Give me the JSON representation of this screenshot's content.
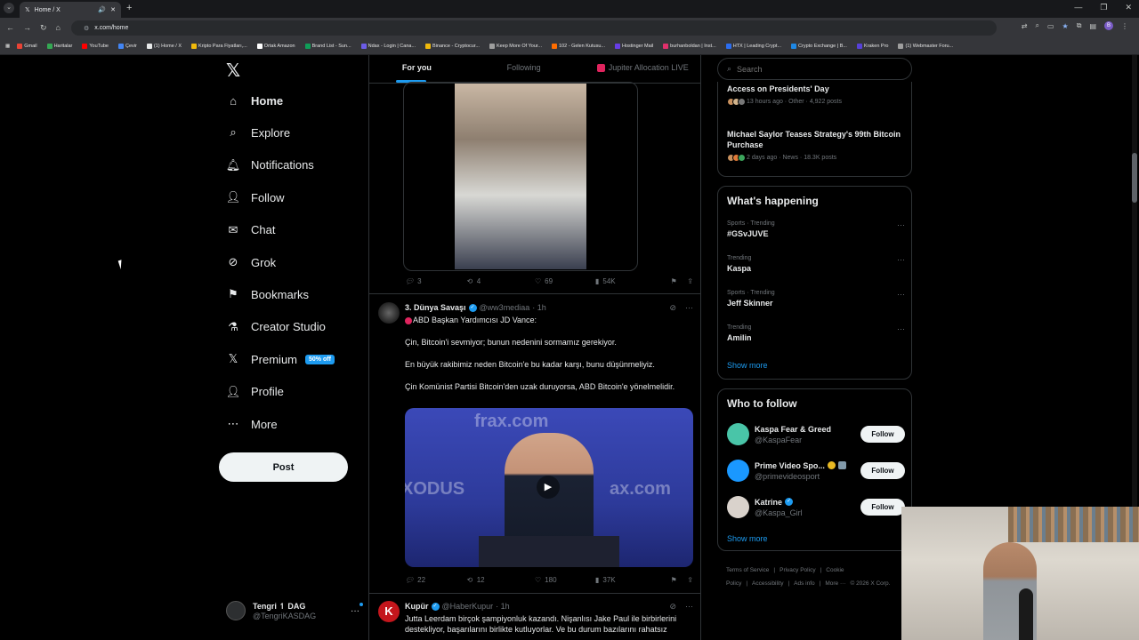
{
  "browser": {
    "tab_title": "Home / X",
    "url": "x.com/home",
    "bookmarks": [
      "Gmail",
      "Haritalar",
      "YouTube",
      "Çevir",
      "(1) Home / X",
      "Kripto Para Fiyatları,...",
      "Ortak Amazon",
      "Brand List - Sun...",
      "Ndax - Login | Cana...",
      "Binance - Cryptocur...",
      "Keep More Of Your...",
      "102 - Gelen Kutusu...",
      "Hostinger Mail",
      "burhanboldan | Inst...",
      "HTX | Leading Crypt...",
      "Crypto Exchange | B...",
      "Kraken Pro",
      "(1) Webmaster Foru..."
    ],
    "bookmark_colors": [
      "#ea4335",
      "#34a853",
      "#ff0000",
      "#4285f4",
      "#e7e9ea",
      "#f0b90b",
      "#ffffff",
      "#0f9d58",
      "#6c5ce7",
      "#f0b90b",
      "#9e9e9e",
      "#ff6d00",
      "#673de6",
      "#e1306c",
      "#2b6def",
      "#1e88e5",
      "#5741d9",
      "#9e9e9e"
    ]
  },
  "nav": {
    "items": [
      {
        "label": "Home",
        "icon": "home-icon",
        "active": true
      },
      {
        "label": "Explore",
        "icon": "search-icon"
      },
      {
        "label": "Notifications",
        "icon": "bell-icon"
      },
      {
        "label": "Follow",
        "icon": "person-plus-icon"
      },
      {
        "label": "Chat",
        "icon": "mail-icon"
      },
      {
        "label": "Grok",
        "icon": "grok-icon"
      },
      {
        "label": "Bookmarks",
        "icon": "bookmark-icon"
      },
      {
        "label": "Creator Studio",
        "icon": "flask-icon"
      },
      {
        "label": "Premium",
        "icon": "x-icon",
        "badge": "50% off"
      },
      {
        "label": "Profile",
        "icon": "person-icon"
      },
      {
        "label": "More",
        "icon": "more-circle-icon"
      }
    ],
    "post_label": "Post",
    "account": {
      "name": "Tengri ↿ DAG",
      "handle": "@TengriKASDAG"
    }
  },
  "feed": {
    "tabs": [
      "For you",
      "Following",
      "Jupiter Allocation LIVE"
    ],
    "tweet1_stats": {
      "replies": "3",
      "reposts": "4",
      "likes": "69",
      "views": "54K"
    },
    "tweet2": {
      "name": "3. Dünya Savaşı",
      "handle": "@ww3mediaa",
      "time": "· 1h",
      "lines": [
        "ABD Başkan Yardımcısı JD Vance:",
        "Çin, Bitcoin'i sevmiyor; bunun nedenini sormamız gerekiyor.",
        "En büyük rakibimiz neden Bitcoin'e bu kadar karşı, bunu düşünmeliyiz.",
        "Çin Komünist Partisi Bitcoin'den uzak duruyorsa, ABD Bitcoin'e yönelmelidir."
      ],
      "media_words": [
        "frax.com",
        "XODUS",
        "ax.com"
      ],
      "stats": {
        "replies": "22",
        "reposts": "12",
        "likes": "180",
        "views": "37K"
      }
    },
    "tweet3": {
      "avatar_letter": "K",
      "name": "Kupür",
      "handle": "@HaberKupur",
      "time": "· 1h",
      "text": "Jutta Leerdam birçok şampiyonluk kazandı. Nişanlısı Jake Paul ile birbirlerini destekliyor, başarılarını birlikte kutluyorlar. Ve bu durum bazılarını rahatsız"
    }
  },
  "sidebar": {
    "search_placeholder": "Search",
    "top_trends": [
      {
        "title": "Access on Presidents' Day",
        "meta": "13 hours ago · Other · 4,922 posts"
      },
      {
        "title": "Michael Saylor Teases Strategy's 99th Bitcoin Purchase",
        "meta": "2 days ago · News · 18.3K posts"
      }
    ],
    "happening_title": "What's happening",
    "trends": [
      {
        "context": "Sports · Trending",
        "topic": "#GSvJUVE"
      },
      {
        "context": "Trending",
        "topic": "Kaspa"
      },
      {
        "context": "Sports · Trending",
        "topic": "Jeff Skinner"
      },
      {
        "context": "Trending",
        "topic": "Amilin"
      }
    ],
    "show_more": "Show more",
    "wtf_title": "Who to follow",
    "who_to_follow": [
      {
        "name": "Kaspa Fear & Greed",
        "handle": "@KaspaFear",
        "color": "#49c5a8"
      },
      {
        "name": "Prime Video Spo...",
        "handle": "@primevideosport",
        "color": "#1a98ff"
      },
      {
        "name": "Katrine",
        "handle": "@Kaspa_Girl",
        "color": "#d9d2cc"
      }
    ],
    "follow_label": "Follow",
    "footer": [
      "Terms of Service",
      "|",
      "Privacy Policy",
      "|",
      "Cookie Policy",
      "|",
      "Accessibility",
      "|",
      "Ads info",
      "|",
      "More ···",
      "© 2026 X Corp."
    ]
  },
  "colors": {
    "accent": "#1d9bf0",
    "background": "#000000",
    "border": "#2f3336",
    "muted": "#71767b"
  }
}
